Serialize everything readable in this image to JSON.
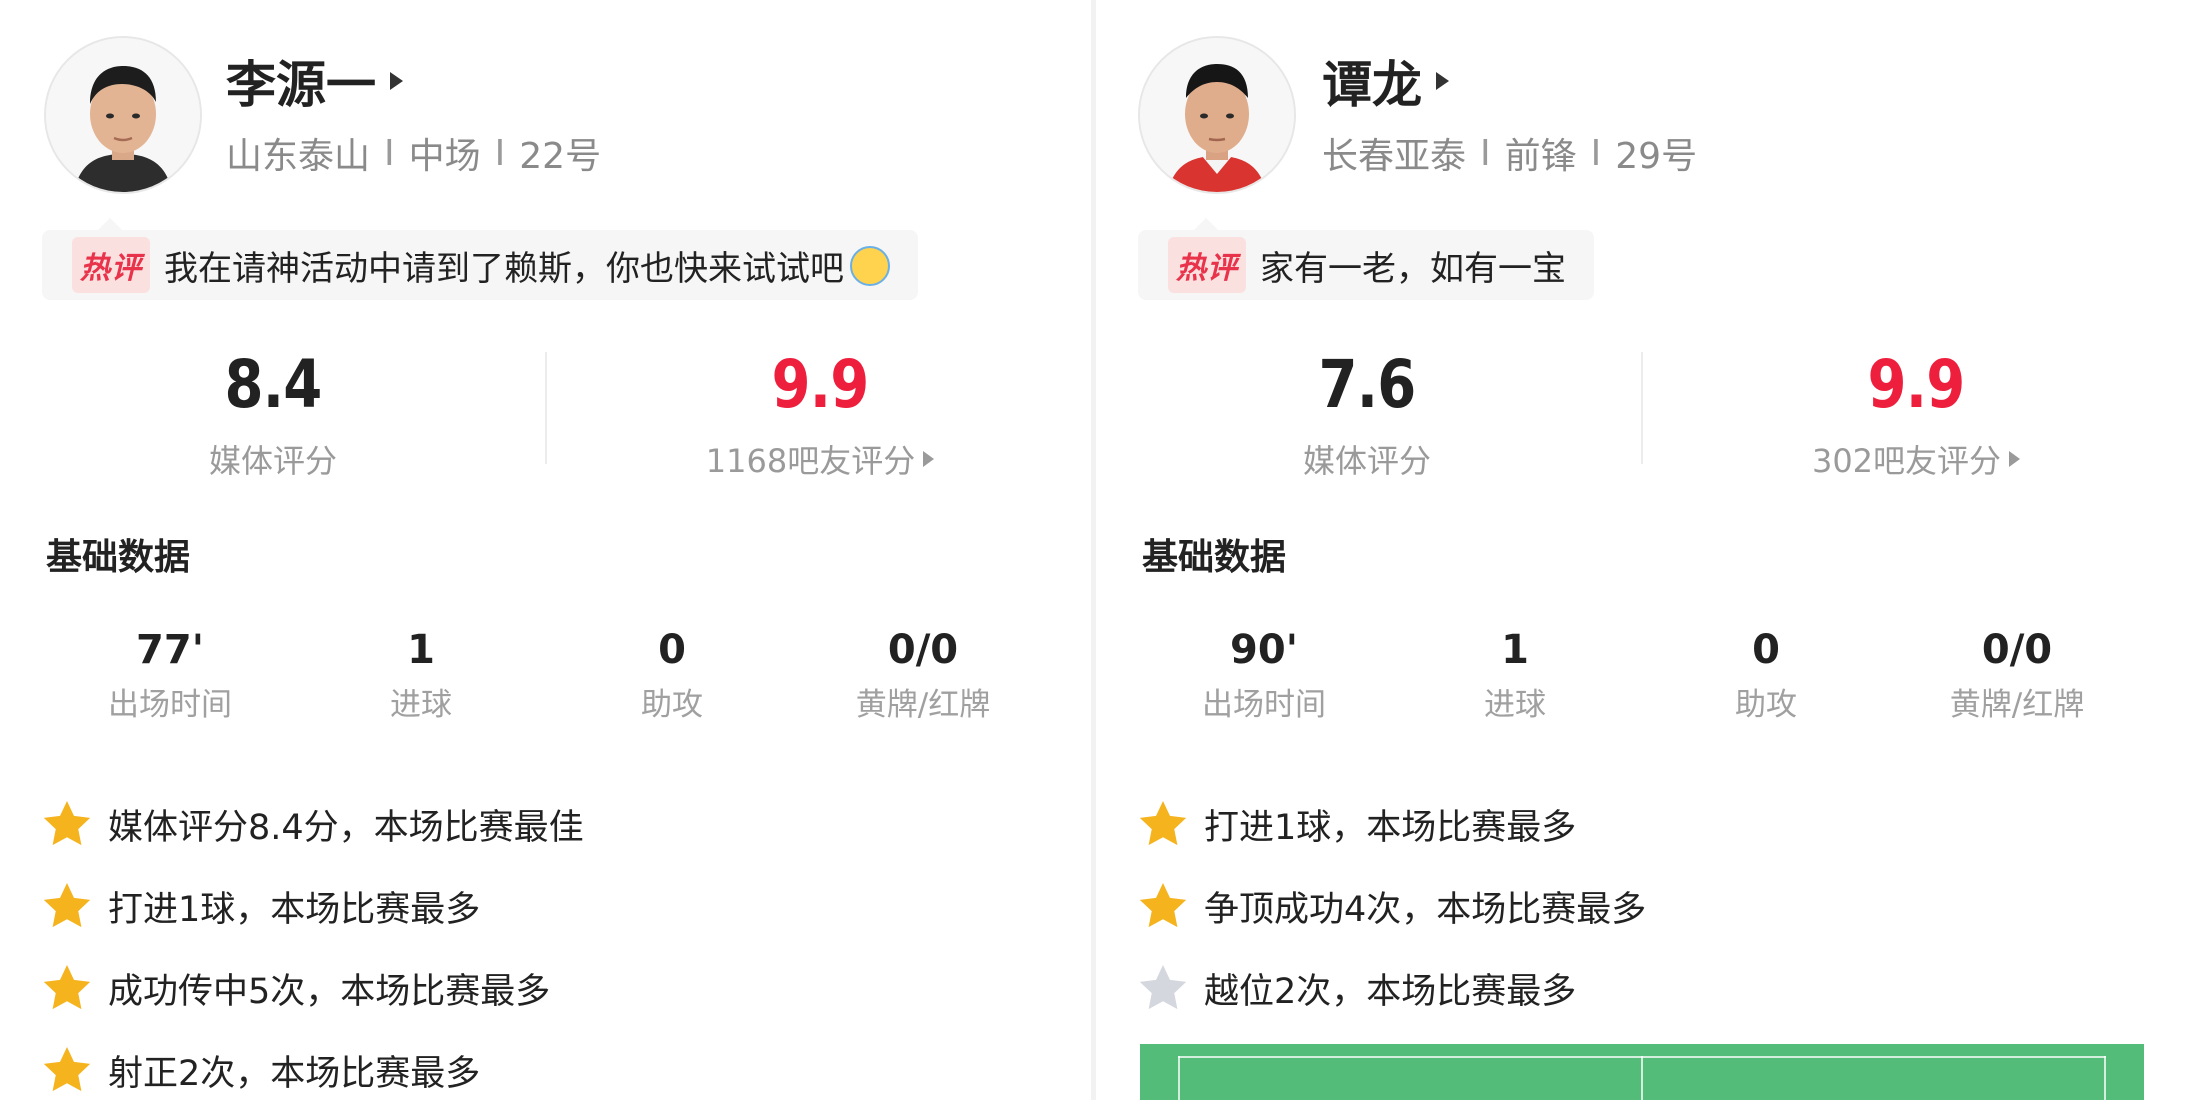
{
  "players": [
    {
      "name": "李源一",
      "team": "山东泰山",
      "position": "中场",
      "number": "22号",
      "hot_badge": "热评",
      "hot_comment": "我在请神活动中请到了赖斯，你也快来试试吧",
      "media_score": "8.4",
      "media_label": "媒体评分",
      "fan_score": "9.9",
      "fan_label": "1168吧友评分",
      "section_title": "基础数据",
      "stats": [
        {
          "value": "77'",
          "label": "出场时间"
        },
        {
          "value": "1",
          "label": "进球"
        },
        {
          "value": "0",
          "label": "助攻"
        },
        {
          "value": "0/0",
          "label": "黄牌/红牌"
        }
      ],
      "highlights": [
        {
          "text": "媒体评分8.4分，本场比赛最佳",
          "star": "gold"
        },
        {
          "text": "打进1球，本场比赛最多",
          "star": "gold"
        },
        {
          "text": "成功传中5次，本场比赛最多",
          "star": "gold"
        },
        {
          "text": "射正2次，本场比赛最多",
          "star": "gold"
        }
      ]
    },
    {
      "name": "谭龙",
      "team": "长春亚泰",
      "position": "前锋",
      "number": "29号",
      "hot_badge": "热评",
      "hot_comment": "家有一老，如有一宝",
      "media_score": "7.6",
      "media_label": "媒体评分",
      "fan_score": "9.9",
      "fan_label": "302吧友评分",
      "section_title": "基础数据",
      "stats": [
        {
          "value": "90'",
          "label": "出场时间"
        },
        {
          "value": "1",
          "label": "进球"
        },
        {
          "value": "0",
          "label": "助攻"
        },
        {
          "value": "0/0",
          "label": "黄牌/红牌"
        }
      ],
      "highlights": [
        {
          "text": "打进1球，本场比赛最多",
          "star": "gold"
        },
        {
          "text": "争顶成功4次，本场比赛最多",
          "star": "gold"
        },
        {
          "text": "越位2次，本场比赛最多",
          "star": "silver"
        }
      ]
    }
  ],
  "meta_separator": "I",
  "colors": {
    "accent_red": "#ee1f3c",
    "star_gold": "#f5b31e",
    "star_silver": "#d4d7de",
    "pitch_green": "#53bc79"
  },
  "icons": {
    "avatar": "player-photo",
    "name_arrow": "triangle-right-icon",
    "star": "star-icon",
    "emoji": "smiling-face-emoji-icon"
  }
}
